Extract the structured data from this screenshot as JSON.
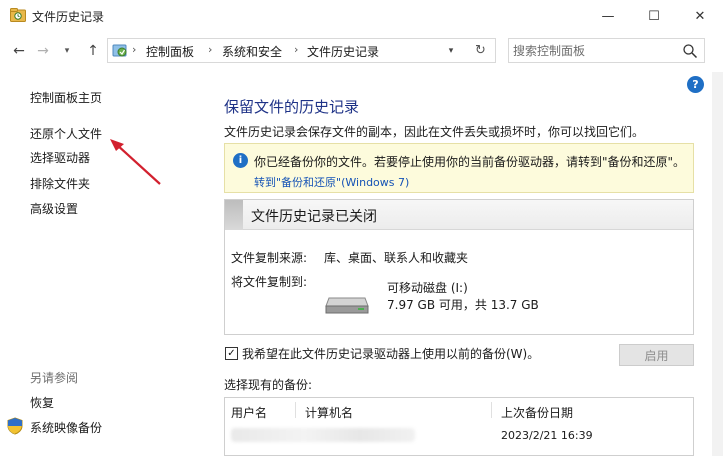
{
  "window": {
    "title": "文件历史记录",
    "min_glyph": "—",
    "max_glyph": "☐",
    "close_glyph": "✕"
  },
  "nav": {
    "back_glyph": "←",
    "forward_glyph": "→",
    "recent_glyph": "▾",
    "up_glyph": "↑",
    "refresh_glyph": "↻",
    "dropdown_glyph": "▾"
  },
  "breadcrumb": {
    "items": [
      "控制面板",
      "系统和安全",
      "文件历史记录"
    ],
    "separator": "›"
  },
  "search": {
    "placeholder": "搜索控制面板",
    "value": ""
  },
  "sidebar": {
    "items": [
      {
        "label": "控制面板主页"
      },
      {
        "label": "还原个人文件"
      },
      {
        "label": "选择驱动器"
      },
      {
        "label": "排除文件夹"
      },
      {
        "label": "高级设置"
      }
    ],
    "see_also_heading": "另请参阅",
    "see_also": [
      {
        "label": "恢复"
      },
      {
        "label": "系统映像备份"
      }
    ]
  },
  "main": {
    "help_glyph": "?",
    "heading": "保留文件的历史记录",
    "description": "文件历史记录会保存文件的副本，因此在文件丢失或损坏时，你可以找回它们。",
    "info": {
      "glyph": "i",
      "text": "你已经备份你的文件。若要停止使用你的当前备份驱动器，请转到\"备份和还原\"。",
      "link": "转到\"备份和还原\"(Windows 7)"
    },
    "status": {
      "title": "文件历史记录已关闭",
      "source_label": "文件复制来源:",
      "source_value": "库、桌面、联系人和收藏夹",
      "dest_label": "将文件复制到:",
      "drive_name": "可移动磁盘 (I:)",
      "drive_space": "7.97 GB 可用，共 13.7 GB"
    },
    "checkbox": {
      "checked": true,
      "glyph": "✓",
      "label": "我希望在此文件历史记录驱动器上使用以前的备份(W)。"
    },
    "enable_button": "启用",
    "select_label": "选择现有的备份:",
    "table": {
      "columns": [
        "用户名",
        "计算机名",
        "上次备份日期"
      ],
      "rows": [
        {
          "date": "2023/2/21 16:39"
        }
      ]
    }
  },
  "colors": {
    "heading": "#1e3287",
    "link": "#1553b6",
    "info_bg": "#fdfbdc",
    "accent": "#1f6fc5",
    "annotation_arrow": "#d2202e"
  }
}
